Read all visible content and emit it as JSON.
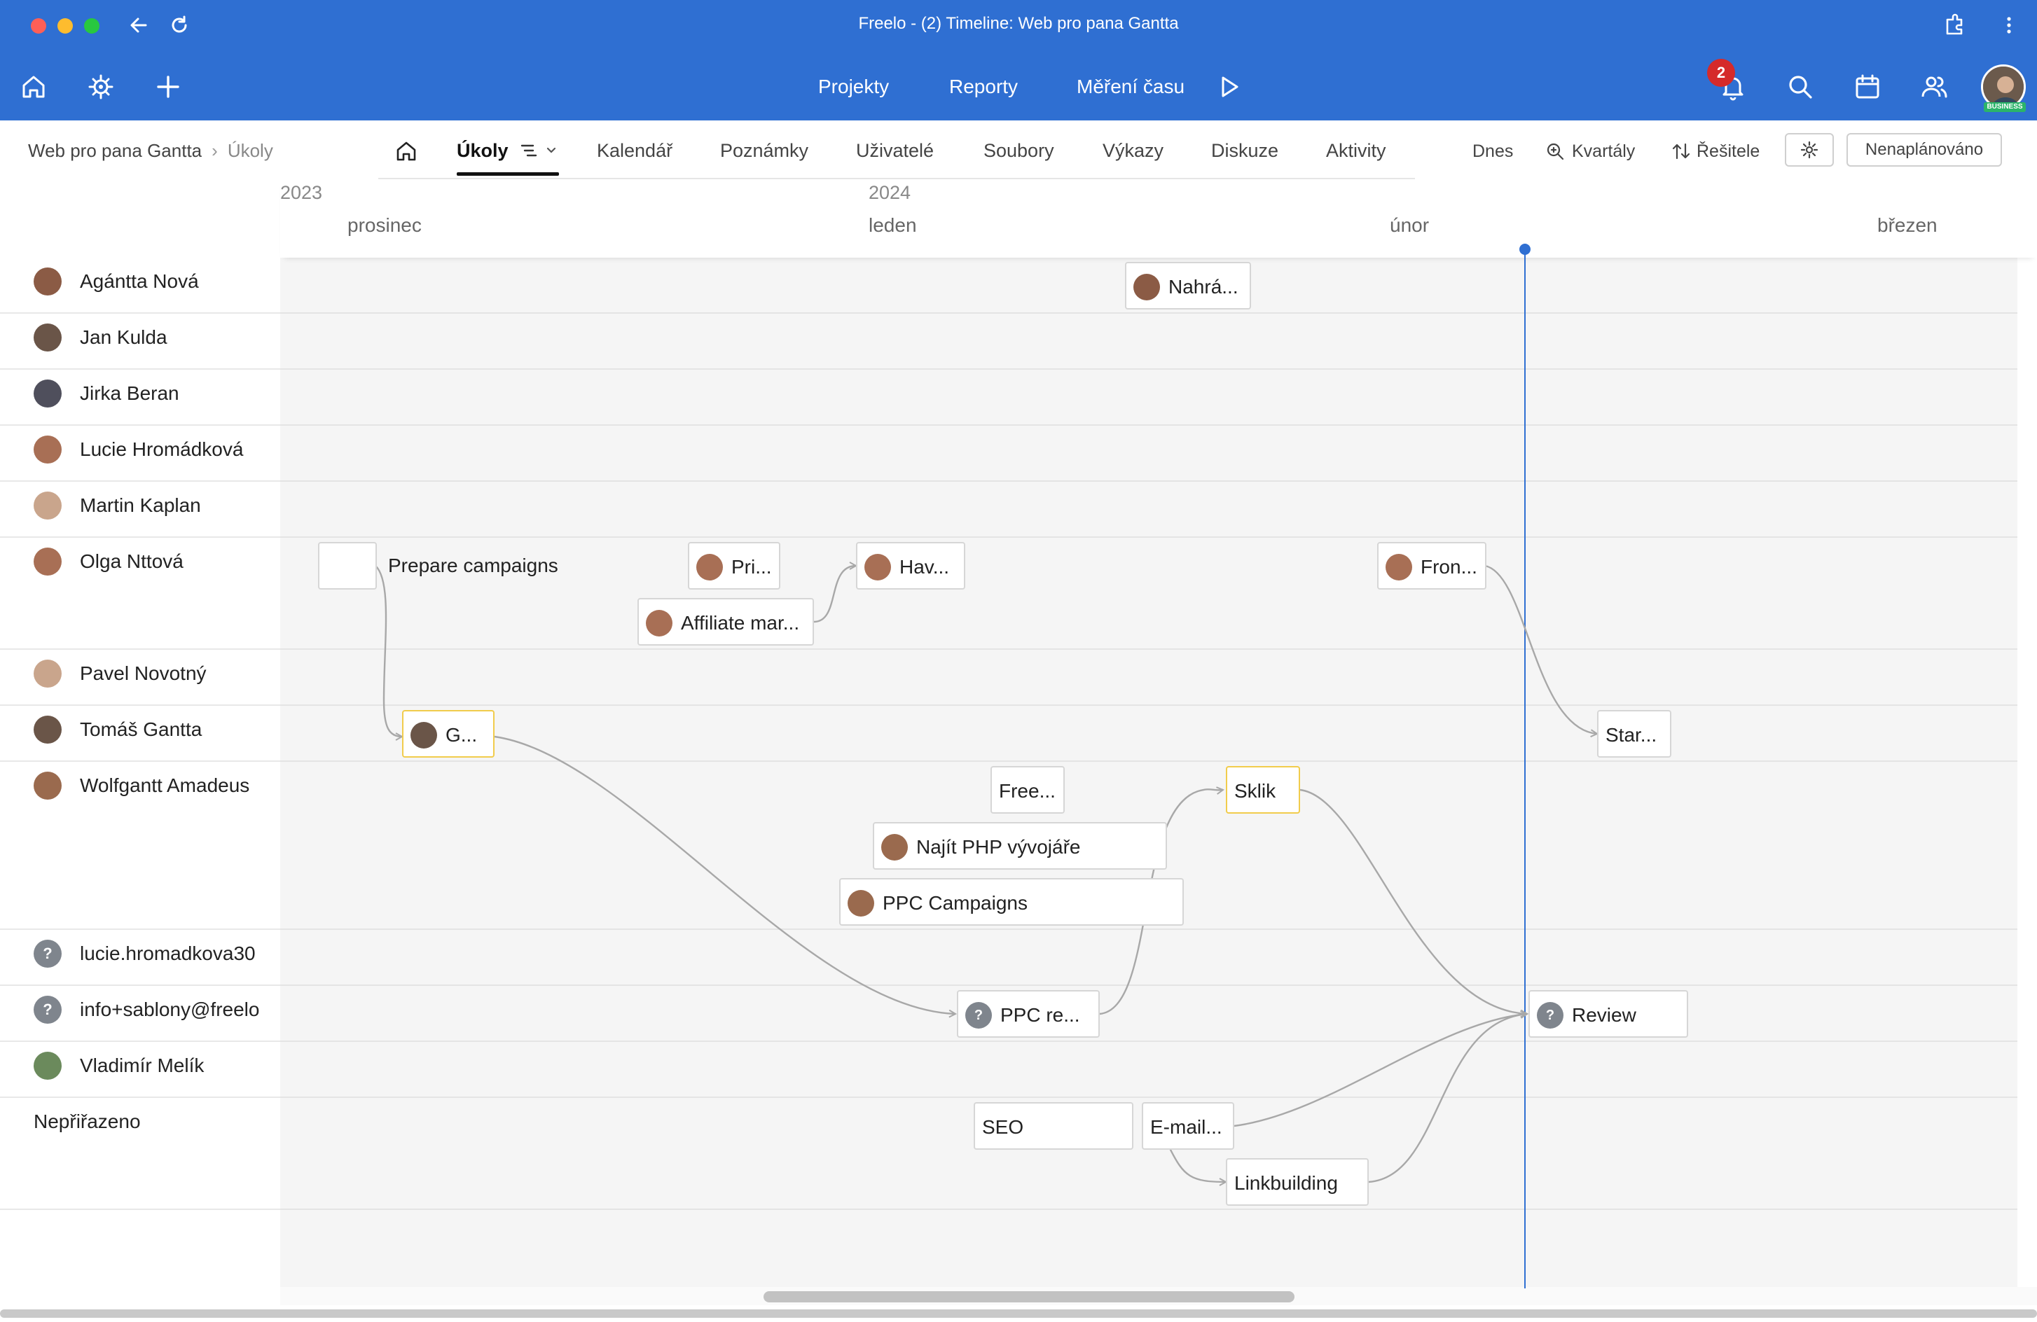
{
  "window": {
    "title": "Freelo - (2) Timeline: Web pro pana Gantta"
  },
  "nav": {
    "links": [
      "Projekty",
      "Reporty",
      "Měření času"
    ],
    "notifications_count": "2",
    "plan_badge": "BUSINESS"
  },
  "breadcrumb": {
    "project": "Web pro pana Gantta",
    "section": "Úkoly"
  },
  "tabs": [
    "Úkoly",
    "Kalendář",
    "Poznámky",
    "Uživatelé",
    "Soubory",
    "Výkazy",
    "Diskuze",
    "Aktivity"
  ],
  "toolbar": {
    "today": "Dnes",
    "zoom": "Kvartály",
    "sort": "Řešitele",
    "unscheduled": "Nenaplánováno"
  },
  "timeline": {
    "years": [
      "2023",
      "2024"
    ],
    "months": [
      "prosinec",
      "leden",
      "únor",
      "březen"
    ]
  },
  "people": [
    {
      "name": "Agántta Nová"
    },
    {
      "name": "Jan Kulda"
    },
    {
      "name": "Jirka Beran"
    },
    {
      "name": "Lucie Hromádková"
    },
    {
      "name": "Martin Kaplan"
    },
    {
      "name": "Olga Nttová"
    },
    {
      "name": "Pavel Novotný"
    },
    {
      "name": "Tomáš Gantta"
    },
    {
      "name": "Wolfgantt Amadeus"
    },
    {
      "name": "lucie.hromadkova30"
    },
    {
      "name": "info+sablony@freelo"
    },
    {
      "name": "Vladimír Melík"
    },
    {
      "name": "Nepřiřazeno"
    }
  ],
  "tasks": {
    "nahra": "Nahrá...",
    "prepare": "Prepare campaigns",
    "pri": "Pri...",
    "hav": "Hav...",
    "affiliate": "Affiliate mar...",
    "fron": "Fron...",
    "g": "G...",
    "star": "Star...",
    "free": "Free...",
    "sklik": "Sklik",
    "najit": "Najít PHP vývojáře",
    "ppc_campaigns": "PPC Campaigns",
    "ppc_re": "PPC re...",
    "review": "Review",
    "seo": "SEO",
    "email": "E-mail...",
    "linkbuilding": "Linkbuilding"
  },
  "unknown_avatar_glyph": "?"
}
